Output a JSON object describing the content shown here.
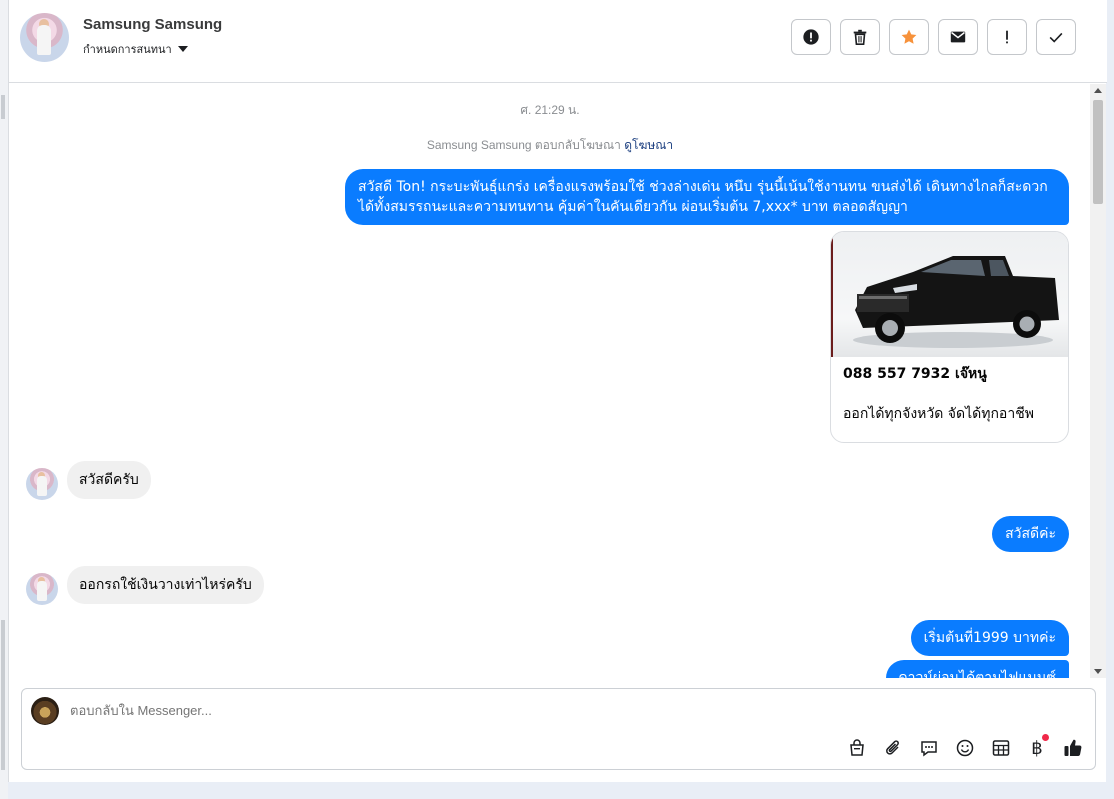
{
  "header": {
    "contact_name": "Samsung Samsung",
    "subtitle": "กำหนดการสนทนา",
    "actions": [
      {
        "name": "alert-icon-button"
      },
      {
        "name": "trash-icon-button"
      },
      {
        "name": "star-icon-button",
        "color": "#f7923b"
      },
      {
        "name": "mail-icon-button"
      },
      {
        "name": "exclamation-icon-button"
      },
      {
        "name": "check-icon-button"
      }
    ]
  },
  "conversation": {
    "timestamp": "ศ. 21:29 น.",
    "reply_note": "Samsung Samsung ตอบกลับโฆษณา",
    "reply_note_link": "ดูโฆษณา",
    "messages": [
      {
        "direction": "out",
        "text": "สวัสดี Ton! กระบะพันธุ์แกร่ง เครื่องแรงพร้อมใช้ ช่วงล่างเด่น หนึบ รุ่นนี้เน้นใช้งานทน ขนส่งได้ เดินทางไกลก็สะดวก ได้ทั้งสมรรถนะและความทนทาน คุ้มค่าในคันเดียวกัน ผ่อนเริ่มต้น 7,xxx* บาท ตลอดสัญญา"
      },
      {
        "direction": "out-card",
        "title": "088 557 7932 เจ๊หนู",
        "description": "ออกได้ทุกจังหวัด จัดได้ทุกอาชีพ"
      },
      {
        "direction": "in",
        "text": "สวัสดีครับ"
      },
      {
        "direction": "out",
        "text": "สวัสดีค่ะ"
      },
      {
        "direction": "in",
        "text": "ออกรถใช้เงินวางเท่าไหร่ครับ"
      },
      {
        "direction": "out",
        "text": "เริ่มต้นที่1999 บาทค่ะ"
      },
      {
        "direction": "out",
        "text": "ดาวน์ผ่อนได้ตามไฟแนนซ์"
      }
    ]
  },
  "composer": {
    "placeholder": "ตอบกลับใน Messenger...",
    "icons": [
      "shopping-bag-icon",
      "paperclip-icon",
      "chat-bubble-icon",
      "emoji-icon",
      "table-icon",
      "baht-icon",
      "thumbs-up-icon"
    ],
    "baht_symbol": "฿",
    "accent": "#0a7cff"
  }
}
